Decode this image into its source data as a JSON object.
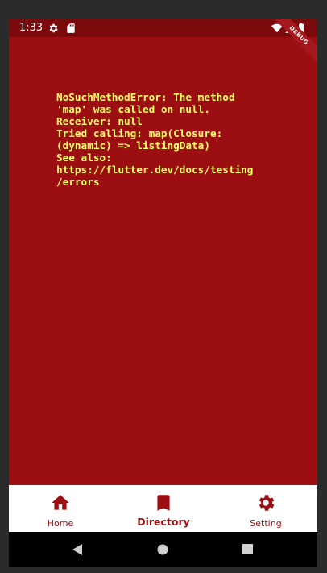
{
  "status_bar": {
    "time": "1:33",
    "icons": [
      "gear-icon",
      "sd-card-icon",
      "wifi-icon",
      "signal-icon",
      "battery-icon"
    ]
  },
  "debug_banner": "DEBUG",
  "error": {
    "lines": [
      "NoSuchMethodError: The method",
      "'map' was called on null.",
      "Receiver: null",
      "Tried calling: map(Closure:",
      "(dynamic) => listingData)",
      "See also:",
      "https://flutter.dev/docs/testing",
      "/errors"
    ]
  },
  "bottom_nav": {
    "items": [
      {
        "label": "Home",
        "icon": "home-icon",
        "active": false
      },
      {
        "label": "Directory",
        "icon": "bookmark-icon",
        "active": true
      },
      {
        "label": "Setting",
        "icon": "gear-icon",
        "active": false
      }
    ]
  },
  "colors": {
    "background": "#9b0f12",
    "status_bar": "#7b0a0d",
    "error_text": "#ffff66",
    "accent": "#9b0f12"
  }
}
